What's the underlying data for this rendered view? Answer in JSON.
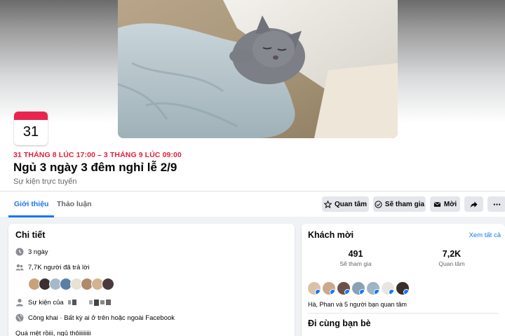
{
  "event": {
    "calendar_day": "31",
    "date_range": "31 THÁNG 8 LÚC 17:00 – 3 THÁNG 9 LÚC 09:00",
    "title": "Ngủ 3 ngày 3 đêm nghỉ lễ 2/9",
    "type": "Sự kiện trực tuyến"
  },
  "tabs": [
    {
      "label": "Giới thiệu",
      "active": true
    },
    {
      "label": "Thảo luận",
      "active": false
    }
  ],
  "actions": {
    "interested": "Quan tâm",
    "going": "Sẽ tham gia",
    "invite": "Mời"
  },
  "details": {
    "heading": "Chi tiết",
    "duration": "3 ngày",
    "responded": "7,7K người đã trả lời",
    "host_prefix": "Sự kiện của",
    "privacy": "Công khai · Bất kỳ ai ở trên hoặc ngoài Facebook",
    "description": "Quá mệt rồiii, ngủ thôiiiiiiii"
  },
  "guests": {
    "heading": "Khách mời",
    "see_all": "Xem tất cả",
    "going_count": "491",
    "going_label": "Sẽ tham gia",
    "interested_count": "7,2K",
    "interested_label": "Quan tâm",
    "friends_text": "Hà, Phan và 5 người bạn quan tâm"
  },
  "friends_section": {
    "heading": "Đi cùng bạn bè"
  },
  "colors": {
    "accent": "#1877f2",
    "date_red": "#e41e3f",
    "calendar_red": "#e9254f"
  },
  "icons": [
    "star-icon",
    "check-circle-icon",
    "envelope-icon",
    "share-icon",
    "more-icon",
    "clock-icon",
    "people-icon",
    "person-icon",
    "globe-icon"
  ]
}
